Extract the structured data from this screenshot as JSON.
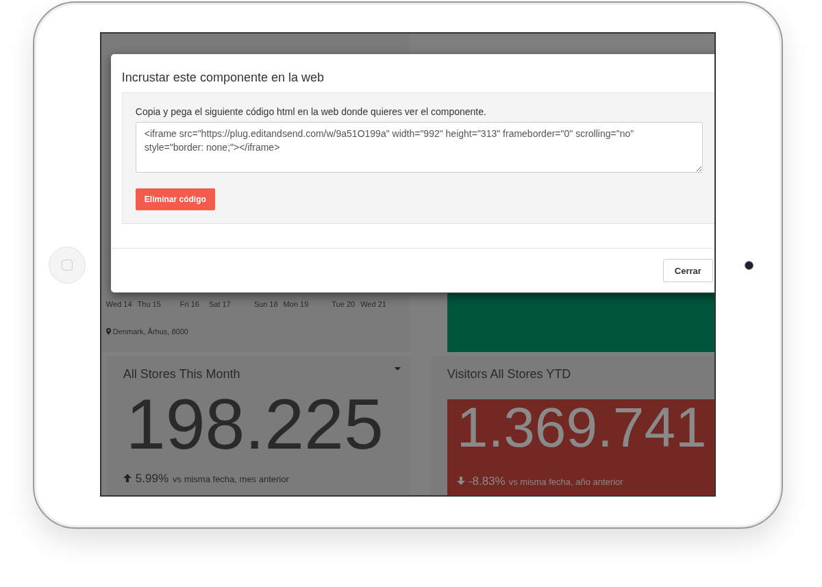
{
  "weather_card": {
    "days": [
      "Wed 14",
      "Thu 15",
      "Fri 16",
      "Sat 17",
      "Sun 18",
      "Mon 19",
      "Tue 20",
      "Wed 21"
    ],
    "location": "Denmark, Århus, 8000"
  },
  "month_card": {
    "title": "All Stores This Month",
    "value": "198.225",
    "kind": "up",
    "change": "5.99%",
    "comparison": "vs misma fecha, mes anterior"
  },
  "ytd_card": {
    "title": "Visitors All Stores YTD",
    "value": "1.369.741",
    "kind": "down",
    "change": "-8.83%",
    "comparison": "vs misma fecha, año anterior"
  },
  "modal": {
    "title": "Incrustar este componente en la web",
    "instruction": "Copia y pega el siguiente código html en la web donde quieres ver el componente.",
    "code": "<iframe src=\"https://plug.editandsend.com/w/9a51O199a\" width=\"992\" height=\"313\" frameborder=\"0\" scrolling=\"no\" style=\"border: none;\"></iframe>",
    "delete_button": "Eliminar código",
    "close_button": "Cerrar"
  }
}
